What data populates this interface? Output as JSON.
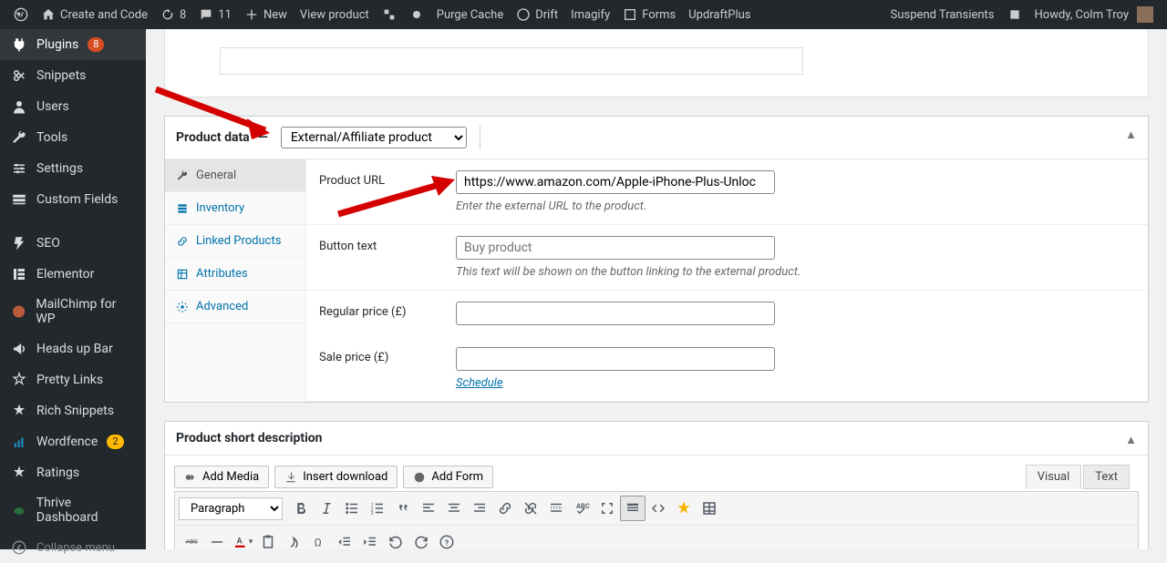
{
  "adminbar": {
    "site": "Create and Code",
    "updates": "8",
    "comments": "11",
    "new": "New",
    "viewProduct": "View product",
    "purgeCache": "Purge Cache",
    "drift": "Drift",
    "imagify": "Imagify",
    "forms": "Forms",
    "updraft": "UpdraftPlus",
    "suspend": "Suspend Transients",
    "howdy": "Howdy, Colm Troy"
  },
  "sidemenu": {
    "plugins": "Plugins",
    "pluginsBadge": "8",
    "snippets": "Snippets",
    "users": "Users",
    "tools": "Tools",
    "settings": "Settings",
    "customFields": "Custom Fields",
    "seo": "SEO",
    "elementor": "Elementor",
    "mailchimp": "MailChimp for WP",
    "headsup": "Heads up Bar",
    "prettylinks": "Pretty Links",
    "richsnippets": "Rich Snippets",
    "wordfence": "Wordfence",
    "wordfenceBadge": "2",
    "ratings": "Ratings",
    "thrive": "Thrive Dashboard",
    "collapse": "Collapse menu"
  },
  "productData": {
    "title": "Product data",
    "type": "External/Affiliate product",
    "tabs": {
      "general": "General",
      "inventory": "Inventory",
      "linked": "Linked Products",
      "attributes": "Attributes",
      "advanced": "Advanced"
    },
    "fields": {
      "urlLabel": "Product URL",
      "urlValue": "https://www.amazon.com/Apple-iPhone-Plus-Unloc",
      "urlHint": "Enter the external URL to the product.",
      "btnTextLabel": "Button text",
      "btnTextPlaceholder": "Buy product",
      "btnTextHint": "This text will be shown on the button linking to the external product.",
      "regularLabel": "Regular price (£)",
      "saleLabel": "Sale price (£)",
      "scheduleLink": "Schedule"
    }
  },
  "shortDesc": {
    "title": "Product short description",
    "addMedia": "Add Media",
    "insertDownload": "Insert download",
    "addForm": "Add Form",
    "visual": "Visual",
    "text": "Text",
    "paragraph": "Paragraph"
  }
}
